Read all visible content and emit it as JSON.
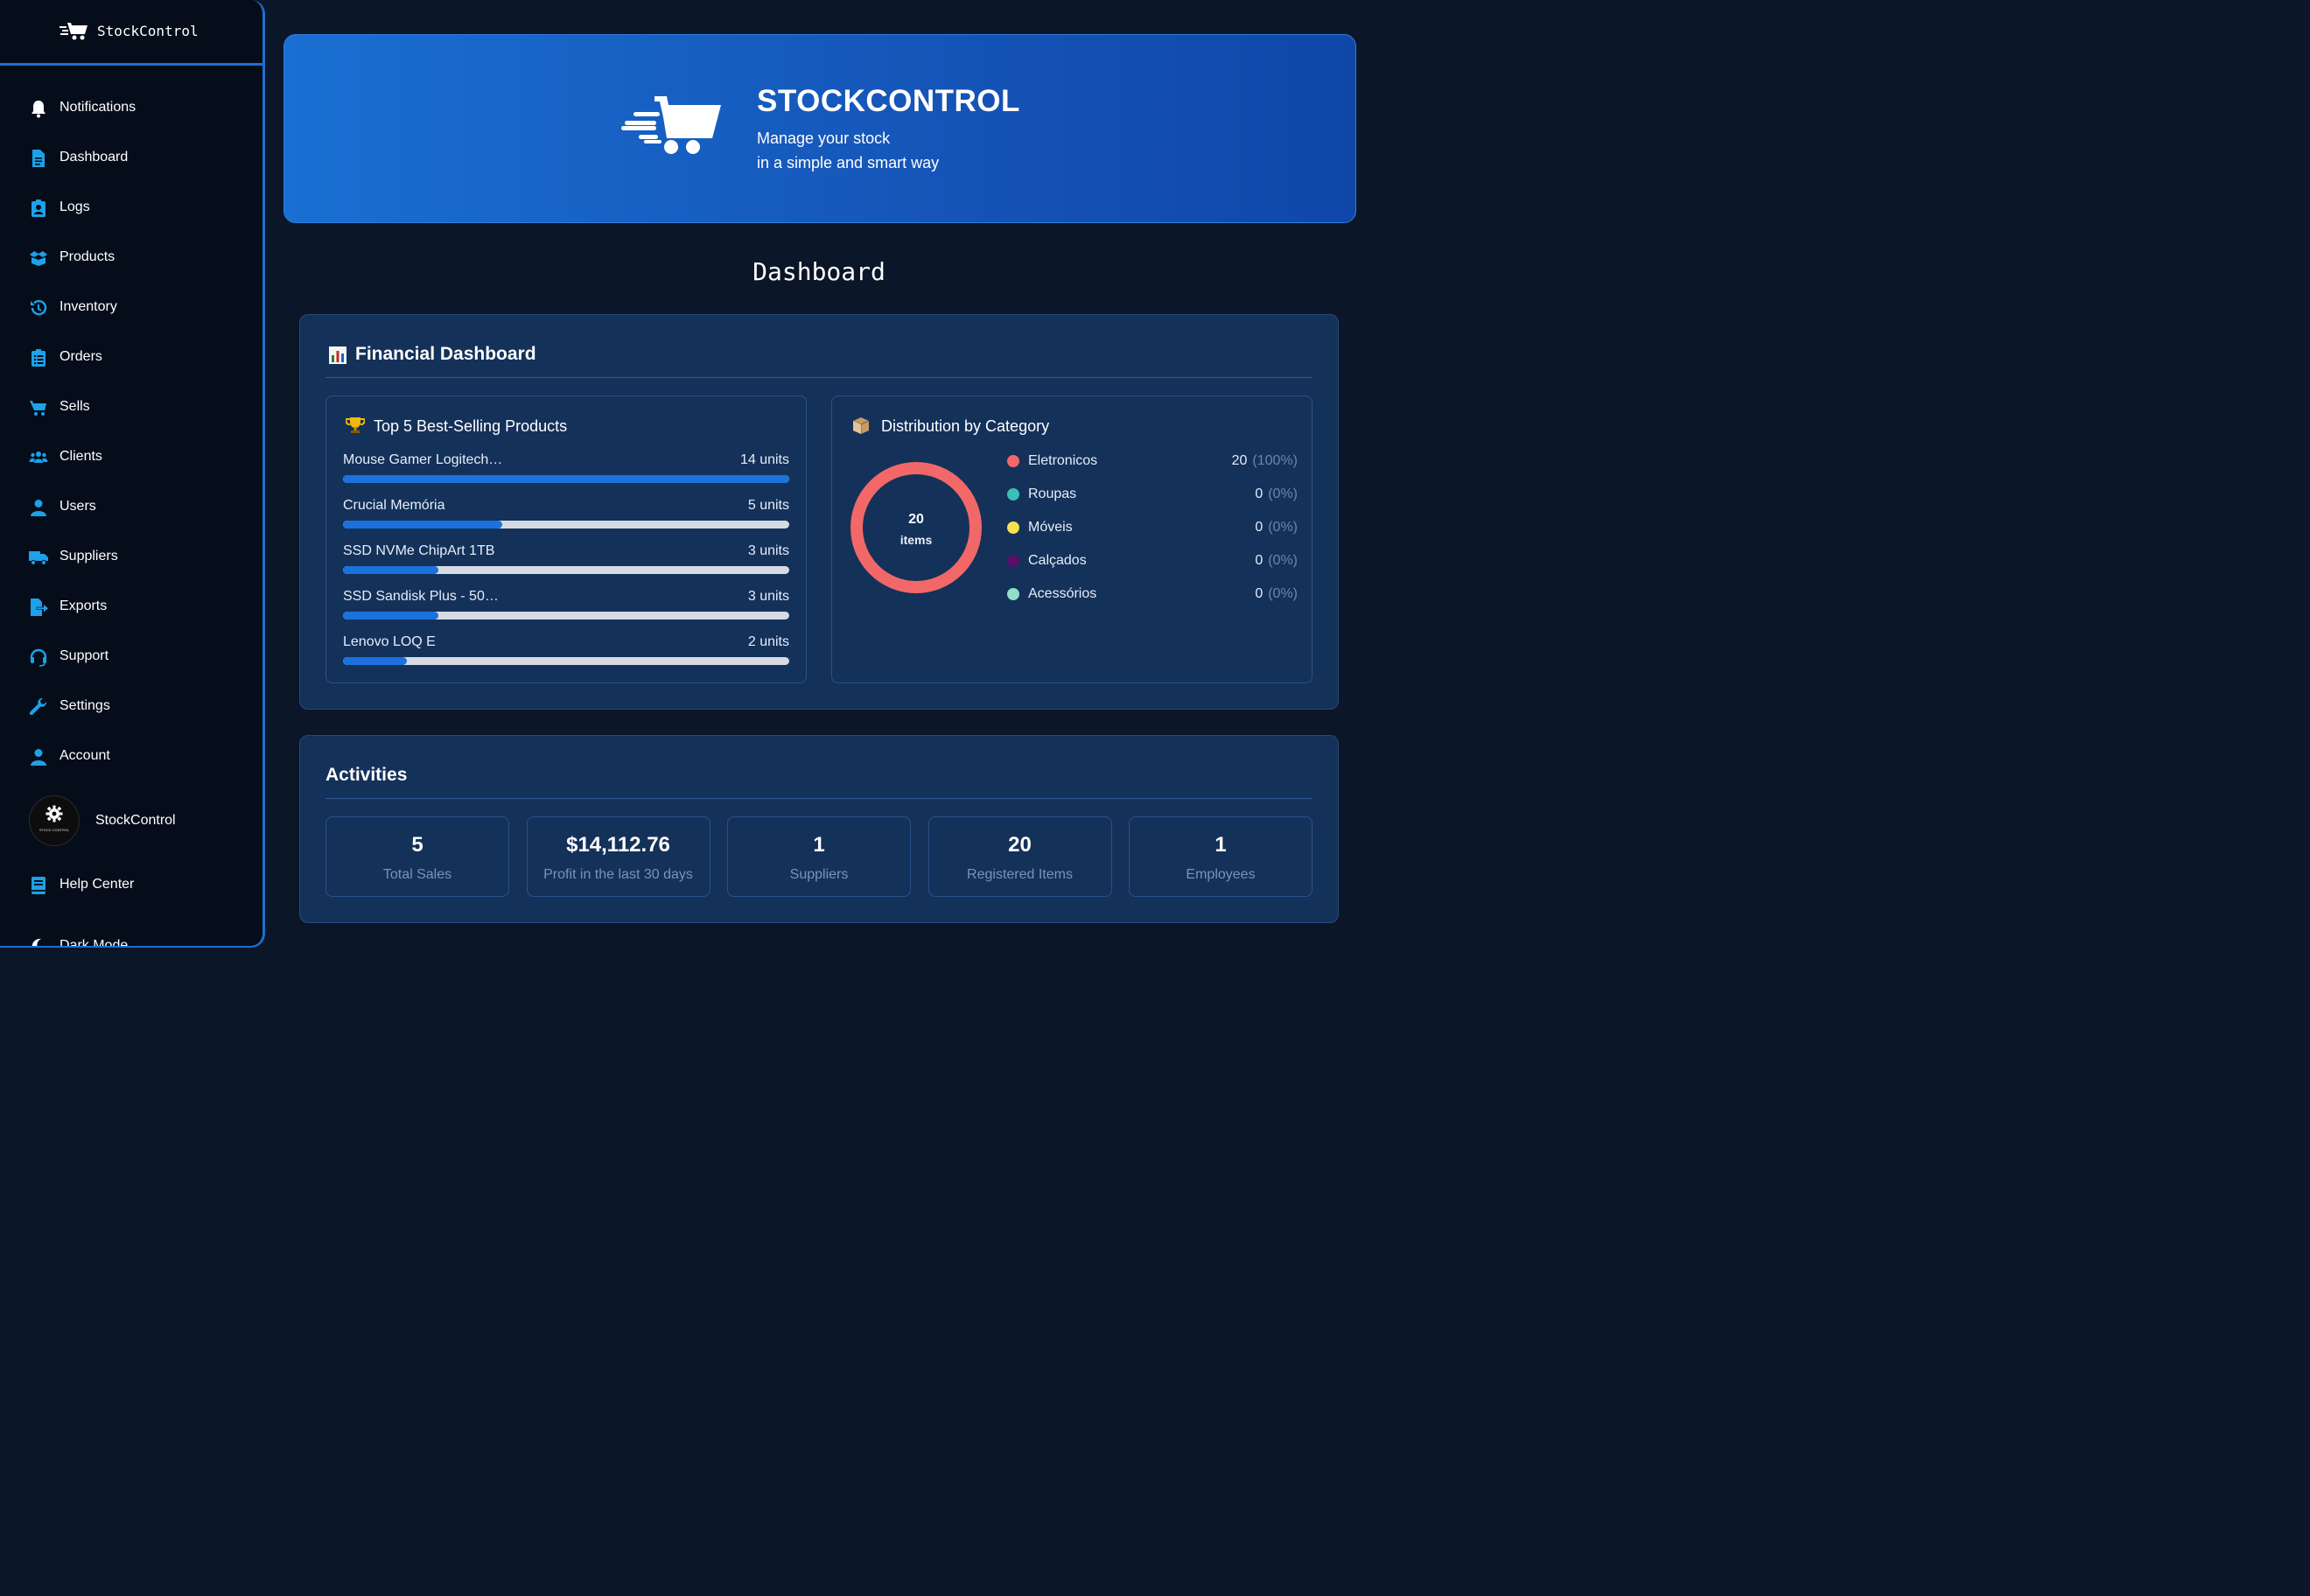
{
  "app": {
    "name": "StockControl"
  },
  "sidebar": {
    "items": [
      {
        "label": "Notifications",
        "icon": "bell-icon"
      },
      {
        "label": "Dashboard",
        "icon": "file-icon"
      },
      {
        "label": "Logs",
        "icon": "id-badge-icon"
      },
      {
        "label": "Products",
        "icon": "box-open-icon"
      },
      {
        "label": "Inventory",
        "icon": "history-icon"
      },
      {
        "label": "Orders",
        "icon": "clipboard-list-icon"
      },
      {
        "label": "Sells",
        "icon": "cart-icon"
      },
      {
        "label": "Clients",
        "icon": "users-icon"
      },
      {
        "label": "Users",
        "icon": "user-icon"
      },
      {
        "label": "Suppliers",
        "icon": "truck-icon"
      },
      {
        "label": "Exports",
        "icon": "file-export-icon"
      },
      {
        "label": "Support",
        "icon": "headset-icon"
      },
      {
        "label": "Settings",
        "icon": "wrench-icon"
      },
      {
        "label": "Account",
        "icon": "user-icon"
      }
    ],
    "profile": {
      "name": "StockControl",
      "avatar_caption": "STOCK CONTROL"
    },
    "help": {
      "label": "Help Center",
      "icon": "book-icon"
    },
    "dark_mode": {
      "label": "Dark Mode",
      "icon": "moon-icon"
    },
    "accent_color": "#1d6fd0",
    "icon_color": "#1da1e8"
  },
  "banner": {
    "title": "STOCKCONTROL",
    "subtitle_line1": "Manage your stock",
    "subtitle_line2": "in a simple and smart way"
  },
  "page_title": "Dashboard",
  "financial": {
    "title": "Financial Dashboard",
    "top_products": {
      "title": "Top 5 Best-Selling Products",
      "items": [
        {
          "name": "Mouse Gamer Logitech…",
          "units_label": "14 units",
          "units": 14
        },
        {
          "name": "Crucial Memória",
          "units_label": "5 units",
          "units": 5
        },
        {
          "name": "SSD NVMe ChipArt 1TB",
          "units_label": "3 units",
          "units": 3
        },
        {
          "name": "SSD Sandisk Plus - 50…",
          "units_label": "3 units",
          "units": 3
        },
        {
          "name": "Lenovo LOQ E",
          "units_label": "2 units",
          "units": 2
        }
      ],
      "max_units": 14
    },
    "distribution": {
      "title": "Distribution by Category",
      "total_value": "20",
      "total_label": "items",
      "categories": [
        {
          "name": "Eletronicos",
          "value": "20",
          "pct": "(100%)",
          "color": "#f26868"
        },
        {
          "name": "Roupas",
          "value": "0",
          "pct": "(0%)",
          "color": "#3cc0b5"
        },
        {
          "name": "Móveis",
          "value": "0",
          "pct": "(0%)",
          "color": "#f7e053"
        },
        {
          "name": "Calçados",
          "value": "0",
          "pct": "(0%)",
          "color": "#5a0f6a"
        },
        {
          "name": "Acessórios",
          "value": "0",
          "pct": "(0%)",
          "color": "#8fe0c6"
        }
      ]
    }
  },
  "activities": {
    "title": "Activities",
    "stats": [
      {
        "value": "5",
        "label": "Total Sales"
      },
      {
        "value": "$14,112.76",
        "label": "Profit in the last 30 days"
      },
      {
        "value": "1",
        "label": "Suppliers"
      },
      {
        "value": "20",
        "label": "Registered Items"
      },
      {
        "value": "1",
        "label": "Employees"
      }
    ]
  }
}
